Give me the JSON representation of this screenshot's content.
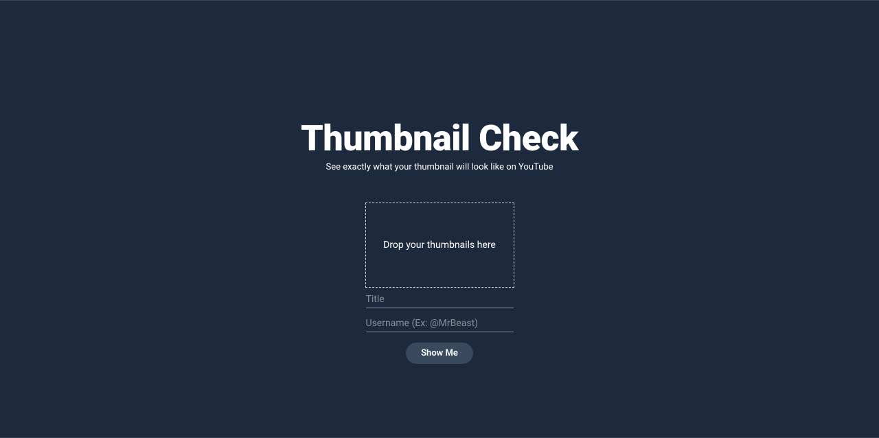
{
  "header": {
    "title": "Thumbnail Check",
    "subtitle": "See exactly what your thumbnail will look like on YouTube"
  },
  "form": {
    "dropzone_text": "Drop your thumbnails here",
    "title_placeholder": "Title",
    "username_placeholder": "Username (Ex: @MrBeast)",
    "submit_label": "Show Me"
  }
}
